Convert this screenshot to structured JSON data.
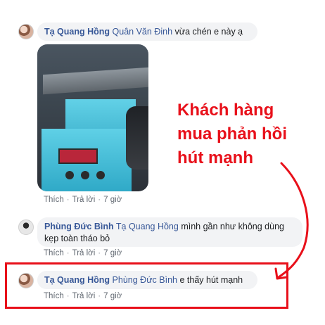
{
  "colors": {
    "link": "#385898",
    "bubble": "#f2f3f5",
    "annotation_red": "#e8101a",
    "meta": "#606770"
  },
  "comments": [
    {
      "author": "Tạ Quang Hồng",
      "mention": "Quân Văn Đinh",
      "text": " vừa chén e này ạ",
      "actions": {
        "like": "Thích",
        "reply": "Trả lời",
        "time": "7 giờ"
      },
      "has_photo": true
    },
    {
      "author": "Phùng Đức Bình",
      "mention": "Tạ Quang Hồng",
      "text": " mình gần như không dùng",
      "text_line2": "kẹp toàn tháo bỏ",
      "actions": {
        "like": "Thích",
        "reply": "Trả lời",
        "time": "7 giờ"
      }
    },
    {
      "author": "Tạ Quang Hồng",
      "mention": "Phùng Đức Bình",
      "text": " e thấy hút mạnh",
      "actions": {
        "like": "Thích",
        "reply": "Trả lời",
        "time": "7 giờ"
      }
    }
  ],
  "annotation": {
    "line1": "Khách hàng",
    "line2": "mua phản hồi",
    "line3": "hút mạnh"
  }
}
